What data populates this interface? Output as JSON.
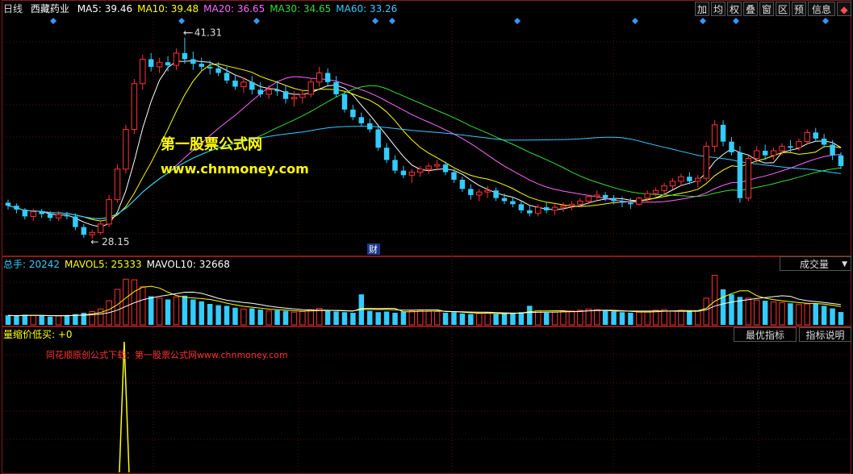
{
  "header": {
    "period": "日线",
    "stock": "西藏药业",
    "ma": [
      {
        "label": "MA5: 39.46",
        "color": "#ffffff"
      },
      {
        "label": "MA10: 39.48",
        "color": "#ffff00"
      },
      {
        "label": "MA20: 36.65",
        "color": "#ff66ff"
      },
      {
        "label": "MA30: 34.65",
        "color": "#33dd33"
      },
      {
        "label": "MA60: 33.26",
        "color": "#33ccff"
      }
    ],
    "toolbar": [
      "加",
      "均",
      "权",
      "叠",
      "窗",
      "区",
      "预",
      "信息"
    ]
  },
  "price_panel": {
    "high_label": "41.31",
    "low_label": "28.15",
    "event_marker": "财",
    "watermark_title": "第一股票公式网",
    "watermark_url": "www.chnmoney.com"
  },
  "volume_panel": {
    "labels": [
      {
        "text": "总手: 20242",
        "color": "#33ccff"
      },
      {
        "text": "MAVOL5: 25333",
        "color": "#ffff00"
      },
      {
        "text": "MAVOL10: 32668",
        "color": "#ffffff"
      }
    ],
    "selector": "成交量"
  },
  "indicator_panel": {
    "label": "量缩价低买: +0",
    "promo_text": "同花顺原创公式下载：第一股票公式网www.chnmoney.com",
    "btn_best": "最优指标",
    "btn_explain": "指标说明"
  },
  "colors": {
    "up": "#ff3333",
    "down": "#33ccff",
    "frame": "#8b1a1a",
    "signal": "#ffff00"
  },
  "chart_data": {
    "type": "candlestick",
    "ylim": [
      27.3,
      42.3
    ],
    "price_labels": {
      "high": 41.31,
      "low": 28.15
    },
    "ohlc": [
      [
        30.5,
        30.7,
        30.05,
        30.3
      ],
      [
        30.3,
        30.45,
        29.8,
        30.05
      ],
      [
        30.05,
        30.15,
        29.4,
        29.6
      ],
      [
        29.6,
        30.1,
        29.3,
        29.9
      ],
      [
        29.9,
        30.1,
        29.5,
        29.75
      ],
      [
        29.75,
        29.95,
        29.3,
        29.5
      ],
      [
        29.5,
        29.95,
        29.3,
        29.7
      ],
      [
        29.7,
        29.9,
        29.4,
        29.6
      ],
      [
        29.6,
        29.8,
        28.7,
        28.9
      ],
      [
        28.9,
        29.1,
        28.2,
        28.4
      ],
      [
        28.4,
        28.7,
        28.15,
        28.55
      ],
      [
        28.55,
        29.3,
        28.4,
        29.1
      ],
      [
        29.1,
        31.0,
        28.9,
        30.7
      ],
      [
        30.7,
        33.0,
        30.5,
        32.7
      ],
      [
        32.7,
        35.6,
        32.4,
        35.3
      ],
      [
        35.3,
        38.6,
        35.0,
        38.3
      ],
      [
        38.3,
        40.2,
        37.9,
        39.9
      ],
      [
        39.9,
        40.3,
        39.1,
        39.4
      ],
      [
        39.4,
        40.0,
        39.0,
        39.7
      ],
      [
        39.7,
        40.1,
        39.1,
        39.5
      ],
      [
        39.5,
        40.6,
        39.2,
        40.3
      ],
      [
        40.3,
        41.31,
        39.6,
        39.9
      ],
      [
        39.9,
        40.4,
        39.2,
        39.6
      ],
      [
        39.6,
        40.0,
        39.1,
        39.4
      ],
      [
        39.4,
        39.8,
        38.9,
        39.3
      ],
      [
        39.3,
        39.7,
        38.8,
        39.0
      ],
      [
        39.0,
        39.4,
        38.3,
        38.5
      ],
      [
        38.5,
        38.9,
        37.9,
        38.1
      ],
      [
        38.1,
        38.7,
        37.7,
        38.4
      ],
      [
        38.4,
        38.8,
        37.6,
        37.9
      ],
      [
        37.9,
        38.4,
        37.4,
        37.6
      ],
      [
        37.6,
        38.2,
        37.3,
        37.9
      ],
      [
        37.9,
        38.5,
        37.5,
        37.8
      ],
      [
        37.8,
        38.2,
        37.0,
        37.3
      ],
      [
        37.3,
        37.8,
        36.8,
        37.4
      ],
      [
        37.4,
        37.9,
        37.0,
        37.6
      ],
      [
        37.6,
        38.6,
        37.4,
        38.4
      ],
      [
        38.4,
        39.4,
        38.1,
        39.0
      ],
      [
        39.0,
        39.3,
        38.2,
        38.4
      ],
      [
        38.4,
        38.8,
        37.4,
        37.6
      ],
      [
        37.6,
        37.8,
        36.4,
        36.6
      ],
      [
        36.6,
        36.9,
        35.9,
        36.1
      ],
      [
        36.1,
        36.4,
        35.5,
        35.7
      ],
      [
        35.7,
        36.0,
        35.1,
        35.3
      ],
      [
        35.3,
        35.5,
        33.9,
        34.1
      ],
      [
        34.1,
        34.4,
        33.1,
        33.3
      ],
      [
        33.3,
        33.6,
        32.4,
        32.6
      ],
      [
        32.6,
        32.9,
        32.1,
        32.3
      ],
      [
        32.3,
        32.7,
        31.8,
        32.5
      ],
      [
        32.5,
        32.9,
        32.2,
        32.7
      ],
      [
        32.7,
        33.1,
        32.4,
        32.9
      ],
      [
        32.9,
        33.3,
        32.6,
        33.0
      ],
      [
        33.0,
        33.2,
        32.3,
        32.5
      ],
      [
        32.5,
        32.7,
        31.8,
        32.0
      ],
      [
        32.0,
        32.2,
        31.2,
        31.4
      ],
      [
        31.4,
        31.7,
        30.7,
        31.0
      ],
      [
        31.0,
        31.4,
        30.6,
        31.2
      ],
      [
        31.2,
        31.6,
        30.8,
        31.3
      ],
      [
        31.3,
        31.5,
        30.6,
        30.8
      ],
      [
        30.8,
        31.1,
        30.4,
        30.6
      ],
      [
        30.6,
        30.9,
        30.2,
        30.4
      ],
      [
        30.4,
        30.6,
        29.8,
        30.0
      ],
      [
        30.0,
        30.3,
        29.6,
        29.8
      ],
      [
        29.8,
        30.4,
        29.6,
        30.2
      ],
      [
        30.2,
        30.5,
        29.8,
        30.0
      ],
      [
        30.0,
        30.4,
        29.7,
        30.2
      ],
      [
        30.2,
        30.5,
        29.9,
        30.3
      ],
      [
        30.3,
        30.6,
        30.0,
        30.4
      ],
      [
        30.4,
        30.8,
        30.2,
        30.6
      ],
      [
        30.6,
        31.0,
        30.4,
        30.9
      ],
      [
        30.9,
        31.3,
        30.7,
        31.0
      ],
      [
        31.0,
        31.2,
        30.6,
        30.8
      ],
      [
        30.8,
        31.0,
        30.4,
        30.6
      ],
      [
        30.6,
        30.9,
        30.2,
        30.5
      ],
      [
        30.5,
        30.8,
        30.1,
        30.4
      ],
      [
        30.4,
        30.9,
        30.3,
        30.8
      ],
      [
        30.8,
        31.3,
        30.6,
        31.1
      ],
      [
        31.1,
        31.5,
        30.9,
        31.3
      ],
      [
        31.3,
        31.8,
        31.0,
        31.6
      ],
      [
        31.6,
        32.1,
        31.4,
        31.9
      ],
      [
        31.9,
        32.4,
        31.6,
        32.2
      ],
      [
        32.2,
        32.5,
        31.7,
        31.9
      ],
      [
        31.9,
        32.3,
        31.5,
        32.1
      ],
      [
        32.1,
        34.5,
        31.9,
        34.2
      ],
      [
        34.2,
        35.9,
        33.8,
        35.6
      ],
      [
        35.6,
        35.9,
        34.2,
        34.5
      ],
      [
        34.5,
        34.8,
        33.6,
        33.8
      ],
      [
        33.8,
        34.2,
        30.5,
        30.8
      ],
      [
        30.8,
        33.6,
        30.6,
        33.4
      ],
      [
        33.4,
        34.2,
        33.1,
        33.9
      ],
      [
        33.9,
        34.3,
        33.3,
        33.6
      ],
      [
        33.6,
        34.1,
        33.3,
        33.9
      ],
      [
        33.9,
        34.4,
        33.6,
        34.2
      ],
      [
        34.2,
        34.6,
        33.8,
        34.1
      ],
      [
        34.1,
        34.7,
        33.9,
        34.5
      ],
      [
        34.5,
        35.3,
        34.3,
        35.1
      ],
      [
        35.1,
        35.4,
        34.5,
        34.7
      ],
      [
        34.7,
        35.0,
        34.1,
        34.3
      ],
      [
        34.3,
        34.6,
        33.3,
        33.6
      ],
      [
        33.6,
        33.8,
        32.7,
        32.9
      ]
    ],
    "ma_series": [
      {
        "name": "MA5",
        "color": "#ffffff",
        "period": 5
      },
      {
        "name": "MA10",
        "color": "#ffff00",
        "period": 10
      },
      {
        "name": "MA20",
        "color": "#ff66ff",
        "period": 20
      },
      {
        "name": "MA30",
        "color": "#33dd33",
        "period": 30
      },
      {
        "name": "MA60",
        "color": "#33ccff",
        "period": 60
      }
    ],
    "volume_ylim": [
      0,
      80000
    ],
    "volume": [
      15000,
      14000,
      16000,
      15000,
      14500,
      13000,
      14000,
      15500,
      17000,
      19000,
      21000,
      25000,
      38000,
      56000,
      72000,
      71000,
      60000,
      45000,
      42000,
      40000,
      44000,
      46000,
      40000,
      37000,
      33000,
      31000,
      30000,
      27000,
      25000,
      26000,
      24000,
      22000,
      23000,
      22000,
      20000,
      21000,
      24000,
      26000,
      22000,
      21000,
      20000,
      19000,
      48000,
      22000,
      20000,
      21000,
      19000,
      21000,
      22000,
      23000,
      22000,
      21000,
      19000,
      20000,
      18000,
      17000,
      18000,
      19000,
      17000,
      18000,
      19000,
      20000,
      30000,
      22000,
      19000,
      20000,
      21000,
      22000,
      23000,
      25000,
      24000,
      22000,
      21000,
      20000,
      19000,
      20000,
      21000,
      23000,
      24000,
      22000,
      23000,
      21000,
      22000,
      42000,
      78000,
      56000,
      48000,
      44000,
      42000,
      39000,
      38000,
      36000,
      35000,
      34000,
      32000,
      33000,
      34000,
      30000,
      26000,
      20242
    ],
    "indicator_series": {
      "name": "量缩价低买",
      "signal_index": 14,
      "signal_value": 1
    }
  }
}
